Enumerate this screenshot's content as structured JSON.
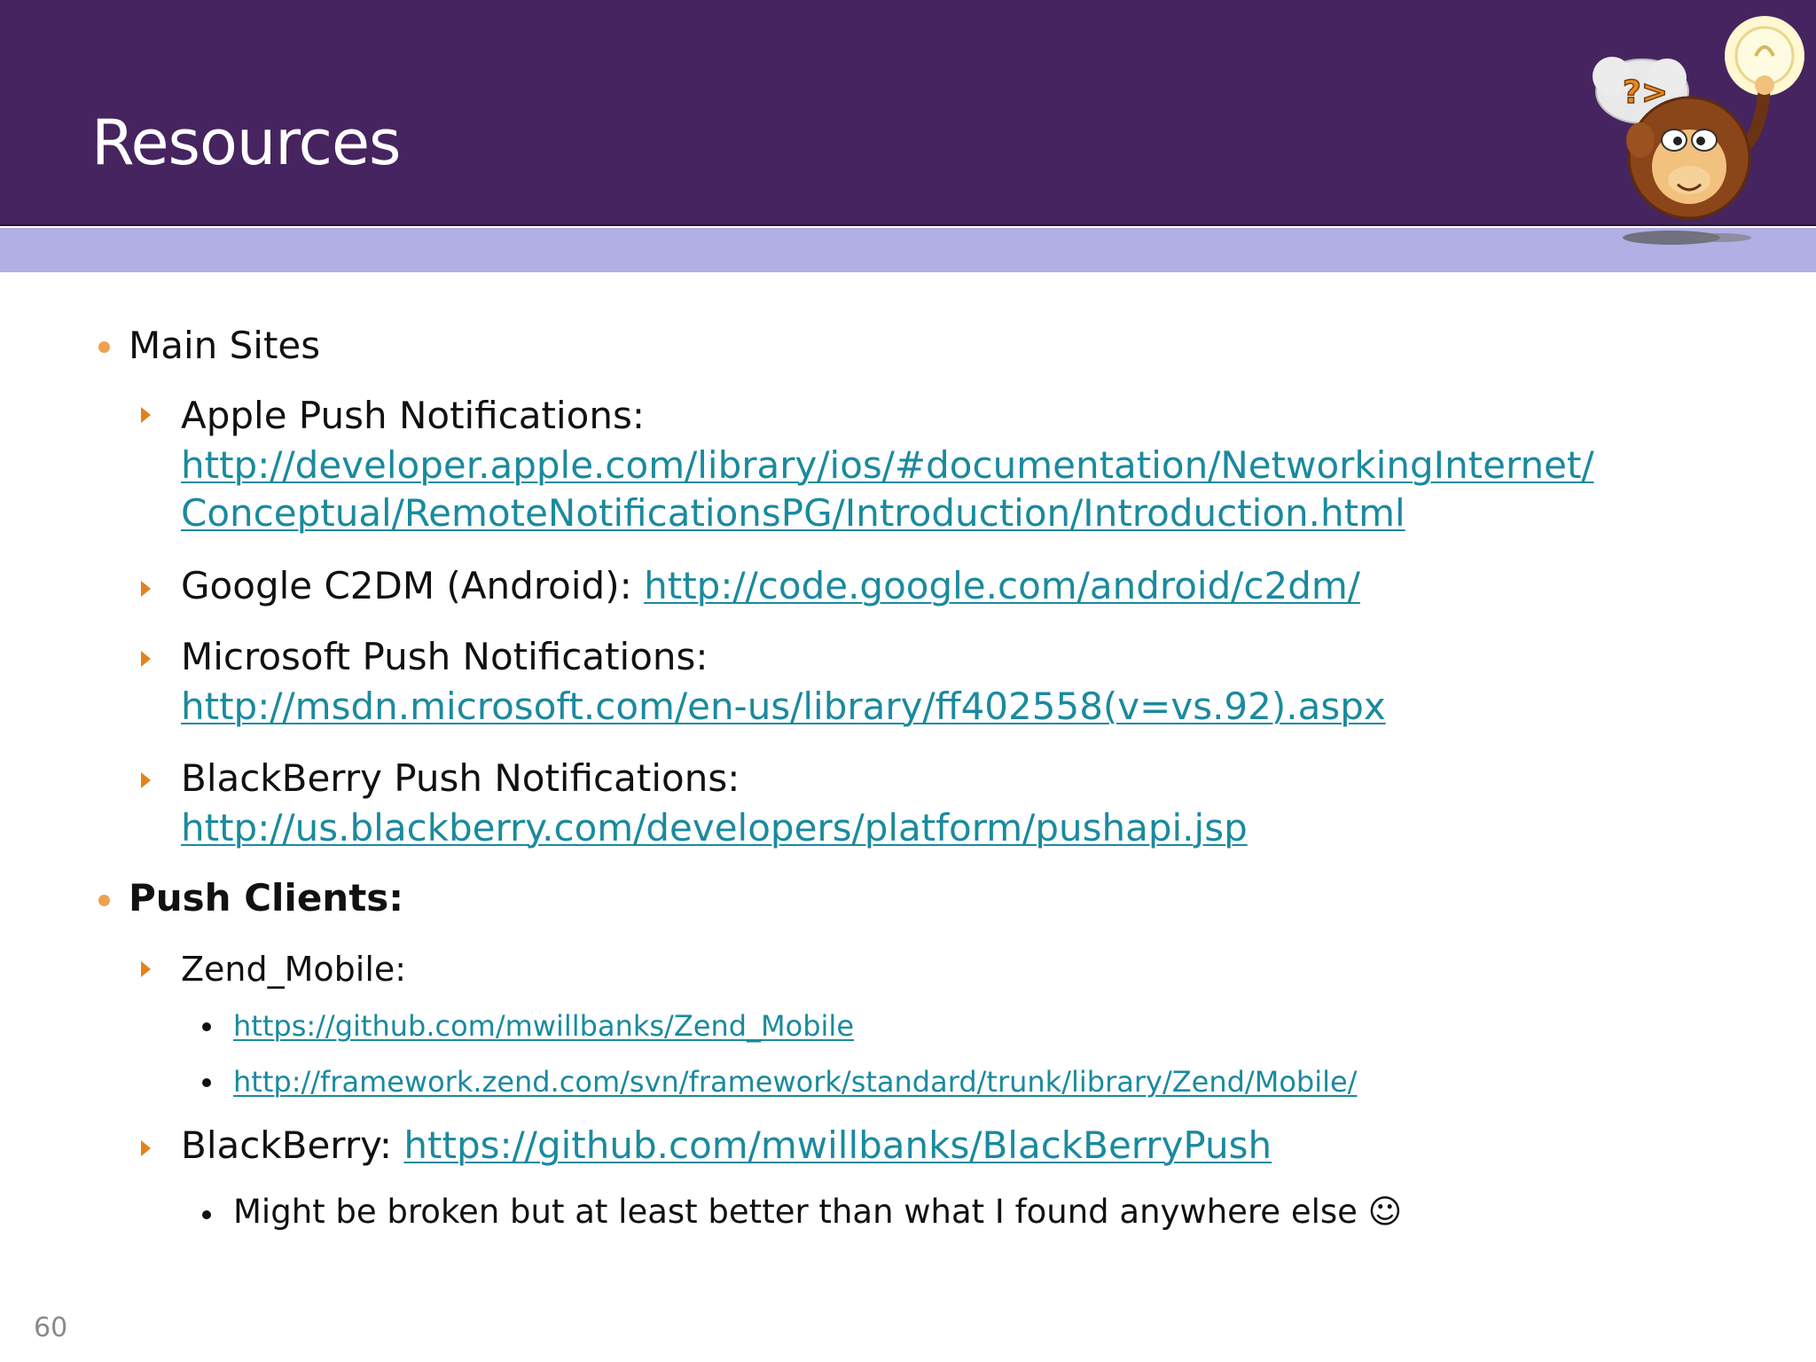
{
  "slide": {
    "title": "Resources",
    "page_number": "60"
  },
  "sections": [
    {
      "heading": "Main Sites",
      "items": [
        {
          "label": "Apple Push Notifications:",
          "link_line1": "http://developer.apple.com/library/ios/#documentation/NetworkingInternet/",
          "link_line2": "Conceptual/RemoteNotificationsPG/Introduction/Introduction.html"
        },
        {
          "label": "Google C2DM (Android):",
          "link": "http://code.google.com/android/c2dm/"
        },
        {
          "label": "Microsoft Push Notifications:",
          "link": "http://msdn.microsoft.com/en-us/library/ff402558(v=vs.92).aspx"
        },
        {
          "label": "BlackBerry Push Notifications:",
          "link": "http://us.blackberry.com/developers/platform/pushapi.jsp"
        }
      ]
    },
    {
      "heading": "Push Clients:",
      "items": [
        {
          "label": "Zend_Mobile:",
          "sub_links": [
            "https://github.com/mwillbanks/Zend_Mobile",
            "http://framework.zend.com/svn/framework/standard/trunk/library/Zend/Mobile/"
          ]
        },
        {
          "label": "BlackBerry:",
          "link": "https://github.com/mwillbanks/BlackBerryPush",
          "note": "Might be broken but at least better than what I found anywhere else ☺"
        }
      ]
    }
  ],
  "colors": {
    "header": "#46245f",
    "band": "#b1afe3",
    "link": "#1a8a9e",
    "bullet": "#f0a050",
    "arrow": "#e3821c"
  },
  "mascot": {
    "icon": "monkey-mascot-icon",
    "bubble_text": "?>"
  }
}
